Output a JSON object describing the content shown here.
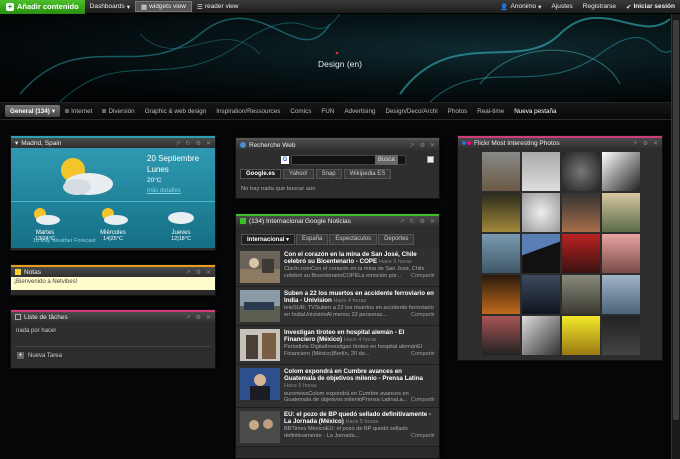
{
  "topbar": {
    "add_label": "Añadir contenido",
    "dashboards": "Dashboards",
    "widgets_view": "widgets view",
    "reader_view": "reader view",
    "user": "Anonimo",
    "settings": "Ajustes",
    "register": "Registrarse",
    "login": "Iniciar sesión"
  },
  "banner": {
    "title": "Design (en)"
  },
  "tabs": [
    "Internet",
    "Diversión",
    "Graphic & web design",
    "Inspiration/Ressources",
    "Comics",
    "FUN",
    "Advertising",
    "Design/Deco/Archi",
    "Photos",
    "Real-time"
  ],
  "tab_first": "General (134)",
  "tab_new": "Nueva pestaña",
  "weather": {
    "title": "Madrid, Spain",
    "date": "20 Septiembre",
    "day": "Lunes",
    "temp": "20°C",
    "more": "más detalles",
    "forecast": [
      {
        "day": "Martes",
        "temp": "13|24°C"
      },
      {
        "day": "Miércoles",
        "temp": "14|25°C"
      },
      {
        "day": "Jueves",
        "temp": "12|18°C"
      }
    ],
    "footer": "10 Day Weather Forecast"
  },
  "notes": {
    "title": "Notas",
    "text": "¡Bienvenido a Netvibes!"
  },
  "todo": {
    "title": "Liste de tâches",
    "empty": "nada por hacer",
    "new_task": "Nueva Tarea"
  },
  "search": {
    "title": "Recherche Web",
    "button": "Busca",
    "placeholder": "",
    "engines": [
      "Google.es",
      "Yahoo!",
      "Snap",
      "Wikipedia ES"
    ],
    "empty": "No hay nada que buscar aún"
  },
  "news": {
    "title": "(134)  Internacional Google Noticias",
    "subtabs": [
      "Internacional",
      "España",
      "Espectáculos",
      "Deportes"
    ],
    "share": "Compartir",
    "items": [
      {
        "title": "Con el corazón en la mina de San José, Chile celebró su Bicentenario - COPE",
        "age": "Hace 3 horas",
        "body": "Clarín.comCon el corazón en la mina de San José, Chile celebró su BicentenarioCOPELa emoción por..."
      },
      {
        "title": "Suben a 22 los muertos en accidente ferroviario en India - Univision",
        "age": "Hace 4 horas",
        "body": "teleSUR: TVSuben a 22 los muertos en accidente ferroviario en IndiaUnivisiónAl menos 22 personas..."
      },
      {
        "title": "Investigan tiroteo en hospital alemán - El Financiero (México)",
        "age": "Hace 4 horas",
        "body": "Periodista DigitalInvestigan tiroteo en hospital alemánEl Financiero (México)Berlín, 20 de..."
      },
      {
        "title": "Colom expondrá en Cumbre avances en Guatemala de objetivos milenio - Prensa Latina",
        "age": "Hace 5 horas",
        "body": "euronewsColom expondrá en Cumbre avances en Guatemala de objetivos milenioPrensa LatinaLa..."
      },
      {
        "title": "EU: el pozo de BP quedó sellado definitivamente - La Jornada (México)",
        "age": "Hace 5 horas",
        "body": "BBTimes MéxicoEU: el pozo de BP quedó sellado definitivamente - La Jornada..."
      }
    ]
  },
  "flickr": {
    "title": "Flickr Most Interesting Photos"
  },
  "colors": {
    "accent_cyan": "#2b9fb5",
    "accent_green": "#3cbf2a",
    "accent_orange": "#e89a1e",
    "accent_pink": "#d23c7a"
  }
}
